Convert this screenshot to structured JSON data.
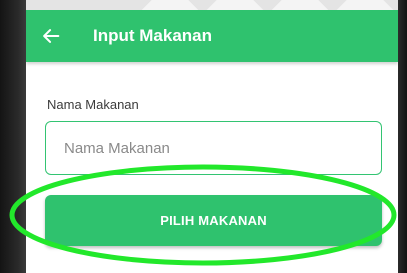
{
  "app_bar": {
    "title": "Input Makanan",
    "back_icon": "arrow-left-icon",
    "color": "#2fc26e"
  },
  "form": {
    "food_name_label": "Nama Makanan",
    "food_name_placeholder": "Nama Makanan",
    "food_name_value": ""
  },
  "actions": {
    "pick_food_label": "PILIH MAKANAN",
    "button_color": "#2fc26e"
  },
  "annotation": {
    "highlight_color": "#22e82b",
    "highlight_shape": "ellipse"
  }
}
